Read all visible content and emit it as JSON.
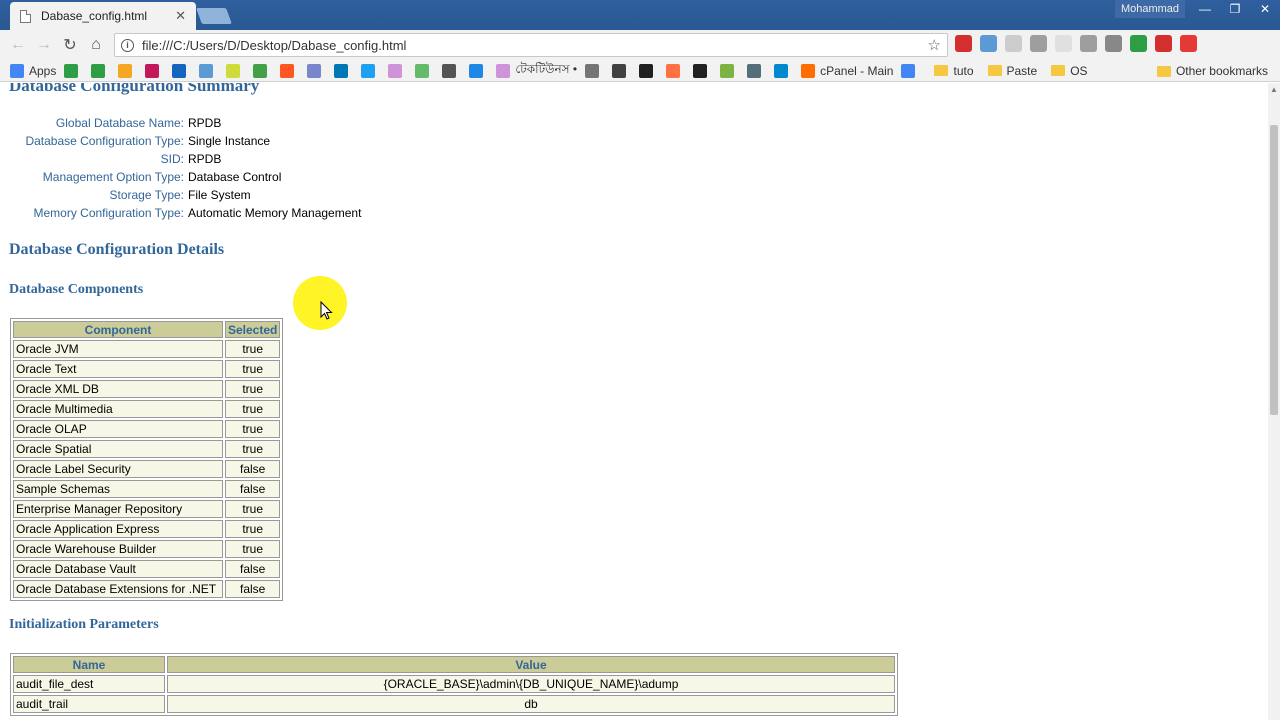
{
  "browser": {
    "tab_title": "Dabase_config.html",
    "tab_close": "✕",
    "user_name": "Mohammad",
    "url": "file:///C:/Users/D/Desktop/Dabase_config.html",
    "window_buttons": [
      "—",
      "❐",
      "✕"
    ],
    "nav": {
      "back": "←",
      "forward": "→",
      "reload": "↻",
      "home": "⌂",
      "star": "☆"
    },
    "extension_colors": [
      "#d32f2f",
      "#5c9ad6",
      "#cccccc",
      "#9e9e9e",
      "#e0e0e0",
      "#9e9e9e",
      "#888888",
      "#2e9e44",
      "#d32f2f",
      "#e53935"
    ],
    "bookmarks": [
      {
        "label": "Apps",
        "color": "#4285f4"
      },
      {
        "label": "",
        "color": "#2e9e44"
      },
      {
        "label": "",
        "color": "#2e9e44"
      },
      {
        "label": "",
        "color": "#f5a623"
      },
      {
        "label": "",
        "color": "#c2185b"
      },
      {
        "label": "",
        "color": "#1565c0"
      },
      {
        "label": "",
        "color": "#5c9ad6"
      },
      {
        "label": "",
        "color": "#cddc39"
      },
      {
        "label": "",
        "color": "#43a047"
      },
      {
        "label": "",
        "color": "#ff5722"
      },
      {
        "label": "",
        "color": "#7986cb"
      },
      {
        "label": "",
        "color": "#0077b5"
      },
      {
        "label": "",
        "color": "#1da1f2"
      },
      {
        "label": "",
        "color": "#ce93d8"
      },
      {
        "label": "",
        "color": "#66bb6a"
      },
      {
        "label": "",
        "color": "#555555"
      },
      {
        "label": "",
        "color": "#1e88e5"
      },
      {
        "label": "টেকটিউনস •",
        "color": "#ce93d8"
      },
      {
        "label": "",
        "color": "#757575"
      },
      {
        "label": "",
        "color": "#424242"
      },
      {
        "label": "",
        "color": "#212121"
      },
      {
        "label": "",
        "color": "#ff7043"
      },
      {
        "label": "",
        "color": "#212121"
      },
      {
        "label": "",
        "color": "#7cb342"
      },
      {
        "label": "",
        "color": "#546e7a"
      },
      {
        "label": "",
        "color": "#0288d1"
      },
      {
        "label": "cPanel - Main",
        "color": "#ff6d00"
      },
      {
        "label": "",
        "color": "#4285f4"
      }
    ],
    "bookmark_folders": [
      "tuto",
      "Paste",
      "OS"
    ],
    "other_bookmarks": "Other bookmarks"
  },
  "page": {
    "summary_heading": "Database Configuration Summary",
    "summary": [
      {
        "key": "Global Database Name:",
        "value": "RPDB"
      },
      {
        "key": "Database Configuration Type:",
        "value": "Single Instance"
      },
      {
        "key": "SID:",
        "value": "RPDB"
      },
      {
        "key": "Management Option Type:",
        "value": "Database Control"
      },
      {
        "key": "Storage Type:",
        "value": "File System"
      },
      {
        "key": "Memory Configuration Type:",
        "value": "Automatic Memory Management"
      }
    ],
    "details_heading": "Database Configuration Details",
    "components_heading": "Database Components",
    "components_columns": [
      "Component",
      "Selected"
    ],
    "components": [
      [
        "Oracle JVM",
        "true"
      ],
      [
        "Oracle Text",
        "true"
      ],
      [
        "Oracle XML DB",
        "true"
      ],
      [
        "Oracle Multimedia",
        "true"
      ],
      [
        "Oracle OLAP",
        "true"
      ],
      [
        "Oracle Spatial",
        "true"
      ],
      [
        "Oracle Label Security",
        "false"
      ],
      [
        "Sample Schemas",
        "false"
      ],
      [
        "Enterprise Manager Repository",
        "true"
      ],
      [
        "Oracle Application Express",
        "true"
      ],
      [
        "Oracle Warehouse Builder",
        "true"
      ],
      [
        "Oracle Database Vault",
        "false"
      ],
      [
        "Oracle Database Extensions for .NET",
        "false"
      ]
    ],
    "init_heading": "Initialization Parameters",
    "init_columns": [
      "Name",
      "Value"
    ],
    "init_params": [
      [
        "audit_file_dest",
        "{ORACLE_BASE}\\admin\\{DB_UNIQUE_NAME}\\adump"
      ],
      [
        "audit_trail",
        "db"
      ]
    ]
  }
}
